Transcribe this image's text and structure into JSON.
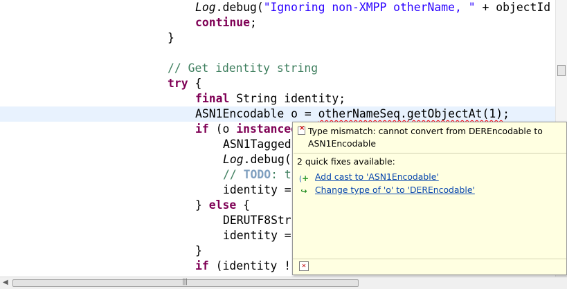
{
  "editor": {
    "lines": [
      {
        "id": "l1",
        "indent": 7,
        "parts": [
          {
            "t": "Log",
            "c": "log"
          },
          {
            "t": ".debug("
          },
          {
            "t": "\"Ignoring non-XMPP otherName, \"",
            "c": "str"
          },
          {
            "t": " + objectId"
          }
        ]
      },
      {
        "id": "l2",
        "indent": 7,
        "parts": [
          {
            "t": "continue",
            "c": "kw"
          },
          {
            "t": ";"
          }
        ]
      },
      {
        "id": "l3",
        "indent": 6,
        "parts": [
          {
            "t": "}"
          }
        ]
      },
      {
        "id": "l4",
        "indent": 6,
        "parts": []
      },
      {
        "id": "l5",
        "indent": 6,
        "parts": [
          {
            "t": "// Get identity string",
            "c": "cmt"
          }
        ]
      },
      {
        "id": "l6",
        "indent": 6,
        "parts": [
          {
            "t": "try",
            "c": "kw"
          },
          {
            "t": " {"
          }
        ]
      },
      {
        "id": "l7",
        "indent": 7,
        "parts": [
          {
            "t": "final",
            "c": "kw"
          },
          {
            "t": " String identity;"
          }
        ]
      },
      {
        "id": "l8",
        "indent": 7,
        "current": true,
        "parts": [
          {
            "t": "ASN1Encodable o = "
          },
          {
            "t": "otherNameSeq.getObjectAt(1)",
            "c": "err"
          },
          {
            "t": ";"
          }
        ]
      },
      {
        "id": "l9",
        "indent": 7,
        "parts": [
          {
            "t": "if",
            "c": "kw"
          },
          {
            "t": " (o "
          },
          {
            "t": "instanceof",
            "c": "kw"
          }
        ]
      },
      {
        "id": "l10",
        "indent": 8,
        "parts": [
          {
            "t": "ASN1Tagged"
          }
        ]
      },
      {
        "id": "l11",
        "indent": 8,
        "parts": [
          {
            "t": "Log",
            "c": "log"
          },
          {
            "t": ".debug("
          }
        ]
      },
      {
        "id": "l12",
        "indent": 8,
        "parts": [
          {
            "t": "// ",
            "c": "cmt"
          },
          {
            "t": "TODO",
            "c": "todo"
          },
          {
            "t": ": t",
            "c": "cmt"
          }
        ]
      },
      {
        "id": "l13",
        "indent": 8,
        "parts": [
          {
            "t": "identity ="
          }
        ]
      },
      {
        "id": "l14",
        "indent": 7,
        "parts": [
          {
            "t": "} "
          },
          {
            "t": "else",
            "c": "kw"
          },
          {
            "t": " {"
          }
        ]
      },
      {
        "id": "l15",
        "indent": 8,
        "parts": [
          {
            "t": "DERUTF8Str"
          }
        ]
      },
      {
        "id": "l16",
        "indent": 8,
        "parts": [
          {
            "t": "identity ="
          }
        ]
      },
      {
        "id": "l17",
        "indent": 7,
        "parts": [
          {
            "t": "}"
          }
        ]
      },
      {
        "id": "l18",
        "indent": 7,
        "parts": [
          {
            "t": "if",
            "c": "kw"
          },
          {
            "t": " (identity !"
          }
        ]
      }
    ]
  },
  "quickfix": {
    "error_message": "Type mismatch: cannot convert from DEREncodable to ASN1Encodable",
    "title": "2 quick fixes available:",
    "fixes": [
      {
        "label": "Add cast to 'ASN1Encodable'",
        "icon": "add-cast-icon"
      },
      {
        "label": "Change type of 'o' to 'DEREncodable'",
        "icon": "change-type-icon"
      }
    ]
  },
  "colors": {
    "keyword": "#7f0055",
    "string": "#2a00ff",
    "comment": "#3f7f5f",
    "popup_bg": "#ffffe1",
    "link": "#0645ad",
    "current_line": "#e8f2fe"
  }
}
